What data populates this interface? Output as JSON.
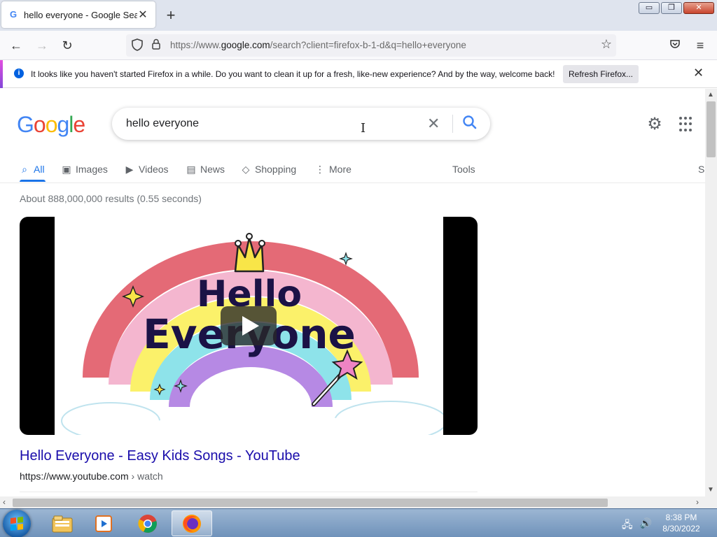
{
  "browser": {
    "tab": {
      "favicon": "G",
      "title": "hello everyone - Google Search",
      "close": "✕"
    },
    "new_tab": "+",
    "window_controls": {
      "minimize": "▭",
      "restore": "❐",
      "close": "✕"
    },
    "nav": {
      "back": "←",
      "forward": "→",
      "reload": "↻"
    },
    "url": {
      "prefix": "https://www.",
      "domain": "google.com",
      "path": "/search?client=firefox-b-1-d&q=hello+everyone"
    },
    "notification": {
      "info_icon": "i",
      "message": "It looks like you haven't started Firefox in a while. Do you want to clean it up for a fresh, like-new experience? And by the way, welcome back!",
      "button": "Refresh Firefox...",
      "close": "✕"
    }
  },
  "google": {
    "logo_letters": [
      "G",
      "o",
      "o",
      "g",
      "l",
      "e"
    ],
    "search": {
      "value": "hello everyone",
      "clear": "✕"
    },
    "tabs": [
      {
        "label": "All",
        "icon": "⌕"
      },
      {
        "label": "Images",
        "icon": "▣"
      },
      {
        "label": "Videos",
        "icon": "▶"
      },
      {
        "label": "News",
        "icon": "▤"
      },
      {
        "label": "Shopping",
        "icon": "◇"
      },
      {
        "label": "More",
        "icon": "⋮"
      }
    ],
    "tools": "Tools",
    "safe_search_partial": "S",
    "stats": "About 888,000,000 results (0.55 seconds)",
    "result": {
      "video_text_line1": "Hello",
      "video_text_line2": "Everyone",
      "title": "Hello Everyone - Easy Kids Songs - YouTube",
      "url": "https://www.youtube.com",
      "crumb": " › watch"
    }
  },
  "taskbar": {
    "clock_time": "8:38 PM",
    "clock_date": "8/30/2022"
  }
}
